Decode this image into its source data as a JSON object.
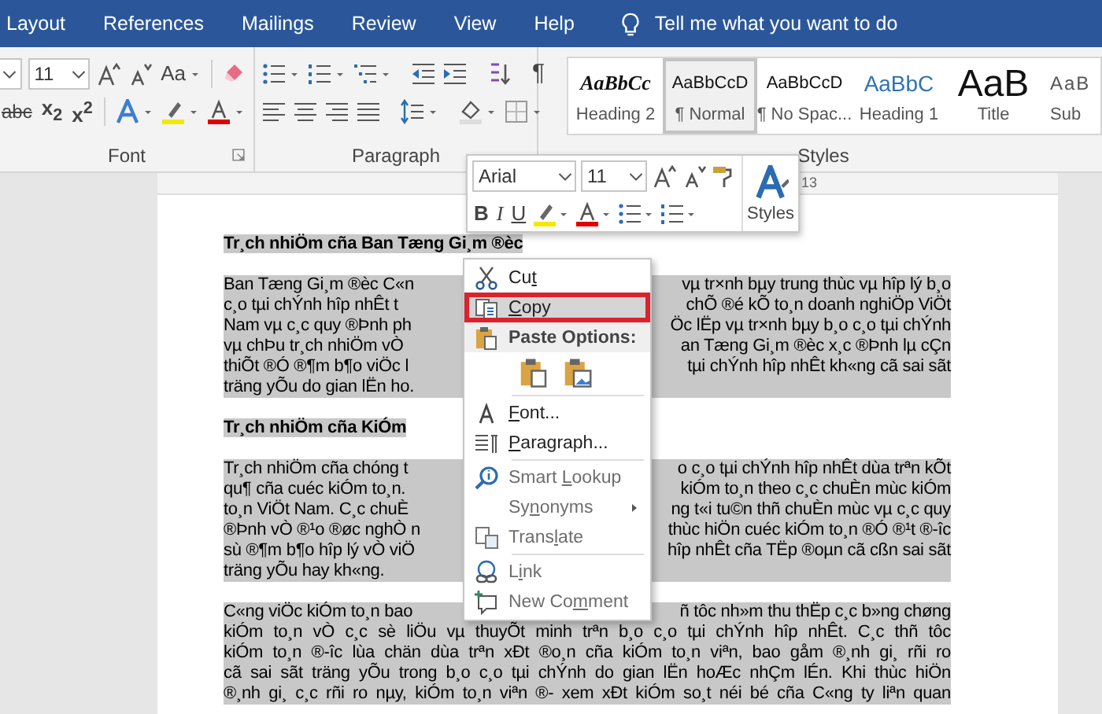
{
  "tabs": [
    {
      "label": "Layout",
      "selected": false
    },
    {
      "label": "References",
      "selected": false
    },
    {
      "label": "Mailings",
      "selected": false
    },
    {
      "label": "Review",
      "selected": false
    },
    {
      "label": "View",
      "selected": false
    },
    {
      "label": "Help",
      "selected": false
    }
  ],
  "tell_me": "Tell me what you want to do",
  "ribbon": {
    "font_group": {
      "size": "11",
      "change_case": "Aa",
      "strikethrough": "abc",
      "subscript": "x$_{2}$",
      "superscript": "x$^{2}$",
      "label": "Font"
    },
    "paragraph_group": {
      "show_marks": "¶",
      "label": "Paragraph"
    },
    "styles": {
      "label": "Styles",
      "items": [
        {
          "preview": "AaBbCc",
          "name": "Heading 2",
          "kind": "heading2",
          "selected": false
        },
        {
          "preview": "AaBbCcD",
          "name": "¶ Normal",
          "kind": "normal",
          "selected": true
        },
        {
          "preview": "AaBbCcD",
          "name": "¶ No Spac...",
          "kind": "normal",
          "selected": false
        },
        {
          "preview": "AaBbC",
          "name": "Heading 1",
          "kind": "heading1",
          "selected": false
        },
        {
          "preview": "AaB",
          "name": "Title",
          "kind": "title",
          "selected": false
        },
        {
          "preview": "AaB",
          "name": "Sub",
          "kind": "subtitle",
          "selected": false
        }
      ]
    }
  },
  "ruler": {
    "mark": "13"
  },
  "mini_toolbar": {
    "font": "Arial",
    "size": "11",
    "bold": "B",
    "italic": "I",
    "underline": "U",
    "styles": "Styles"
  },
  "document": {
    "blocks": [
      {
        "kind": "heading",
        "selected": true,
        "lines": [
          {
            "left": "Tr¸ch nhiÖm cña Ban Tæng Gi¸m ®èc"
          }
        ]
      },
      {
        "kind": "paragraph",
        "selected": true,
        "lines": [
          {
            "left": "Ban Tæng Gi¸m ®èc C«n",
            "right": "vµ tr×nh bµy trung thùc vµ hîp lý b¸o"
          },
          {
            "left": "c¸o tµi chÝnh hîp nhÊt t",
            "right": "chÕ ®é kÕ to¸n doanh nghiÖp ViÖt"
          },
          {
            "left": "Nam vµ c¸c quy ®Þnh ph",
            "right": "Öc lËp vµ tr×nh bµy b¸o c¸o tµi chÝnh"
          },
          {
            "left": "vµ chÞu tr¸ch nhiÖm vÒ",
            "right": "an Tæng Gi¸m ®èc x¸c ®Þnh lµ cÇn"
          },
          {
            "left": "thiÕt ®Ó ®¶m b¶o viÖc l",
            "right": "tµi chÝnh hîp nhÊt kh«ng cã sai sãt"
          },
          {
            "left": "träng yÕu do gian lËn ho."
          }
        ]
      },
      {
        "kind": "heading",
        "selected": true,
        "lines": [
          {
            "left": "Tr¸ch nhiÖm cña KiÓm"
          }
        ]
      },
      {
        "kind": "paragraph",
        "selected": true,
        "lines": [
          {
            "left": "Tr¸ch nhiÖm cña chóng t",
            "right": "o c¸o tµi chÝnh hîp nhÊt dùa trªn kÕt"
          },
          {
            "left": "qu¶ cña cuéc kiÓm to¸n.",
            "right": "kiÓm to¸n theo c¸c chuÈn mùc kiÓm"
          },
          {
            "left": "to¸n ViÖt Nam. C¸c chuÈ",
            "right": "ng t«i tu©n thñ chuÈn mùc vµ c¸c quy"
          },
          {
            "left": "®Þnh vÒ ®¹o ®øc nghÒ n",
            "right": "thùc hiÖn cuéc kiÓm to¸n ®Ó ®¹t ®-îc"
          },
          {
            "left": "sù ®¶m b¶o hîp lý vÒ viÖ",
            "right": "hîp nhÊt cña TËp ®oµn cã cßn sai sãt"
          },
          {
            "left": "träng yÕu hay kh«ng."
          }
        ]
      },
      {
        "kind": "paragraph",
        "selected": true,
        "lines": [
          {
            "left": "C«ng viÖc kiÓm to¸n bao",
            "right": "ñ tôc nh»m thu thËp c¸c b»ng chøng"
          },
          {
            "text": "kiÓm to¸n vÒ c¸c sè liÖu vµ thuyÕt minh trªn b¸o c¸o tµi chÝnh hîp nhÊt. C¸c thñ tôc"
          },
          {
            "text": "kiÓm to¸n ®-îc lùa chän dùa trªn xÐt ®o¸n cña kiÓm to¸n viªn, bao gåm ®¸nh gi¸ rñi ro"
          },
          {
            "text": "cã sai sãt träng yÕu trong b¸o c¸o tµi chÝnh do gian lËn hoÆc nhÇm lÉn. Khi thùc hiÖn"
          },
          {
            "text": "®¸nh gi¸ c¸c rñi ro nµy, kiÓm to¸n viªn ®- xem xÐt kiÓm so¸t néi bé cña C«ng ty liªn quan"
          }
        ]
      }
    ]
  },
  "context_menu": {
    "items": [
      {
        "kind": "item",
        "pre": "Cu",
        "key": "t",
        "selected": false,
        "disabled": false,
        "submenu": false
      },
      {
        "kind": "item",
        "key": "C",
        "post": "opy",
        "selected": true,
        "disabled": false,
        "submenu": false
      },
      {
        "kind": "header",
        "label": "Paste Options:"
      },
      {
        "kind": "paste"
      },
      {
        "kind": "separator"
      },
      {
        "kind": "item",
        "key": "F",
        "post": "ont...",
        "selected": false,
        "disabled": false,
        "submenu": false
      },
      {
        "kind": "item",
        "key": "P",
        "post": "aragraph...",
        "selected": false,
        "disabled": false,
        "submenu": false
      },
      {
        "kind": "separator"
      },
      {
        "kind": "item",
        "pre": "Smart ",
        "key": "L",
        "post": "ookup",
        "selected": false,
        "disabled": true,
        "submenu": false
      },
      {
        "kind": "item",
        "pre": "Sy",
        "key": "n",
        "post": "onyms",
        "selected": false,
        "disabled": true,
        "submenu": true
      },
      {
        "kind": "item",
        "pre": "Trans",
        "key": "l",
        "post": "ate",
        "selected": false,
        "disabled": true,
        "submenu": false
      },
      {
        "kind": "separator"
      },
      {
        "kind": "item",
        "pre": "L",
        "key": "i",
        "post": "nk",
        "selected": false,
        "disabled": true,
        "submenu": false
      },
      {
        "kind": "item",
        "pre": "New Co",
        "key": "m",
        "post": "ment",
        "selected": false,
        "disabled": true,
        "submenu": false
      }
    ]
  }
}
